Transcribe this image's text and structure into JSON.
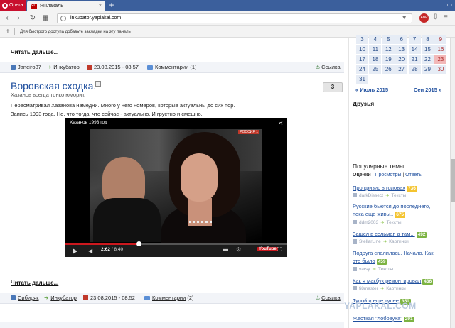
{
  "browser": {
    "menu_label": "Opera",
    "tab_title": "ЯПлакаль",
    "tab_favicon": "ЯП",
    "url_domain": "inkubator.yaplakal.com",
    "speed_dial_hint": "Для быстрого доступа добавьте закладки на эту панель",
    "abp_label": "ABP"
  },
  "post_prev": {
    "read_more": "Читать дальше...",
    "author": "Janeiro87",
    "section": "Инкубатор",
    "date": "23.08.2015 - 08:57",
    "comments_label": "Комментарии",
    "comments_count": "(1)",
    "link_label": "Ссылка"
  },
  "post": {
    "title": "Воровская сходка.",
    "subtitle": "Хазанов всегда тонко юморит.",
    "rating": "3",
    "body_line1": "Пересматривал Хазанова намедни. Много у него номеров, которые актуальны до сих пор.",
    "body_line2": "Запись 1993 года. Но, что тогда, что сейчас - актуально. И грустно и смешно.",
    "video": {
      "title": "Хазанов 1993 год",
      "channel": "РОССИЯ 1",
      "time_current": "2:62",
      "time_total": "8:40",
      "progress_fraction": 0.33,
      "yt_label": "YouTube"
    },
    "read_more": "Читать дальше...",
    "author": "Сибиряк",
    "section": "Инкубатор",
    "date": "23.08.2015 - 08:52",
    "comments_label": "Комментарии",
    "comments_count": "(2)",
    "link_label": "Ссылка"
  },
  "calendar": {
    "rows": [
      [
        "3",
        "4",
        "5",
        "6",
        "7",
        "8",
        "9"
      ],
      [
        "10",
        "11",
        "12",
        "13",
        "14",
        "15",
        "16"
      ],
      [
        "17",
        "18",
        "19",
        "20",
        "21",
        "22",
        "23"
      ],
      [
        "24",
        "25",
        "26",
        "27",
        "28",
        "29",
        "30"
      ],
      [
        "31",
        "",
        "",
        "",
        "",
        "",
        ""
      ]
    ],
    "today": "23",
    "prev": "« Июль 2015",
    "next": "Сен 2015 »"
  },
  "sidebar": {
    "friends_title": "Друзья",
    "popular_title": "Популярные темы",
    "tab_ratings": "Оценки",
    "tab_views": "Просмотры",
    "tab_replies": "Ответы",
    "items": [
      {
        "title_1": "Про кризис в головах",
        "title_2": "",
        "score": "736",
        "author": "darkDissect",
        "category": "Тексты",
        "color": "#f4c430"
      },
      {
        "title_1": "Русские бьются до последнего,",
        "title_2": "пока еще живы..",
        "score": "675",
        "author": "ddm2003",
        "category": "Тексты",
        "color": "#f4c430"
      },
      {
        "title_1": "Зашел в сельмаг, а там...",
        "title_2": "",
        "score": "492",
        "author": "StellarLine",
        "category": "Картинки",
        "color": "#7cb342"
      },
      {
        "title_1": "Подруга спалилась. Начало. Как",
        "title_2": "это было",
        "score": "459",
        "author": "varsy",
        "category": "Тексты",
        "color": "#7cb342"
      },
      {
        "title_1": "Как я макбук ремонтировал",
        "title_2": "",
        "score": "436",
        "author": "fi8master",
        "category": "Картинки",
        "color": "#7cb342"
      },
      {
        "title_1": "Тупой и еще тупее",
        "title_2": "",
        "score": "350",
        "author": "",
        "category": "",
        "color": "#7cb342"
      },
      {
        "title_1": "Жесткая \"лобовуха\"",
        "title_2": "",
        "score": "291",
        "author": "",
        "category": "",
        "color": "#7cb342"
      }
    ],
    "watermark": "YAPLAKAL.COM"
  }
}
